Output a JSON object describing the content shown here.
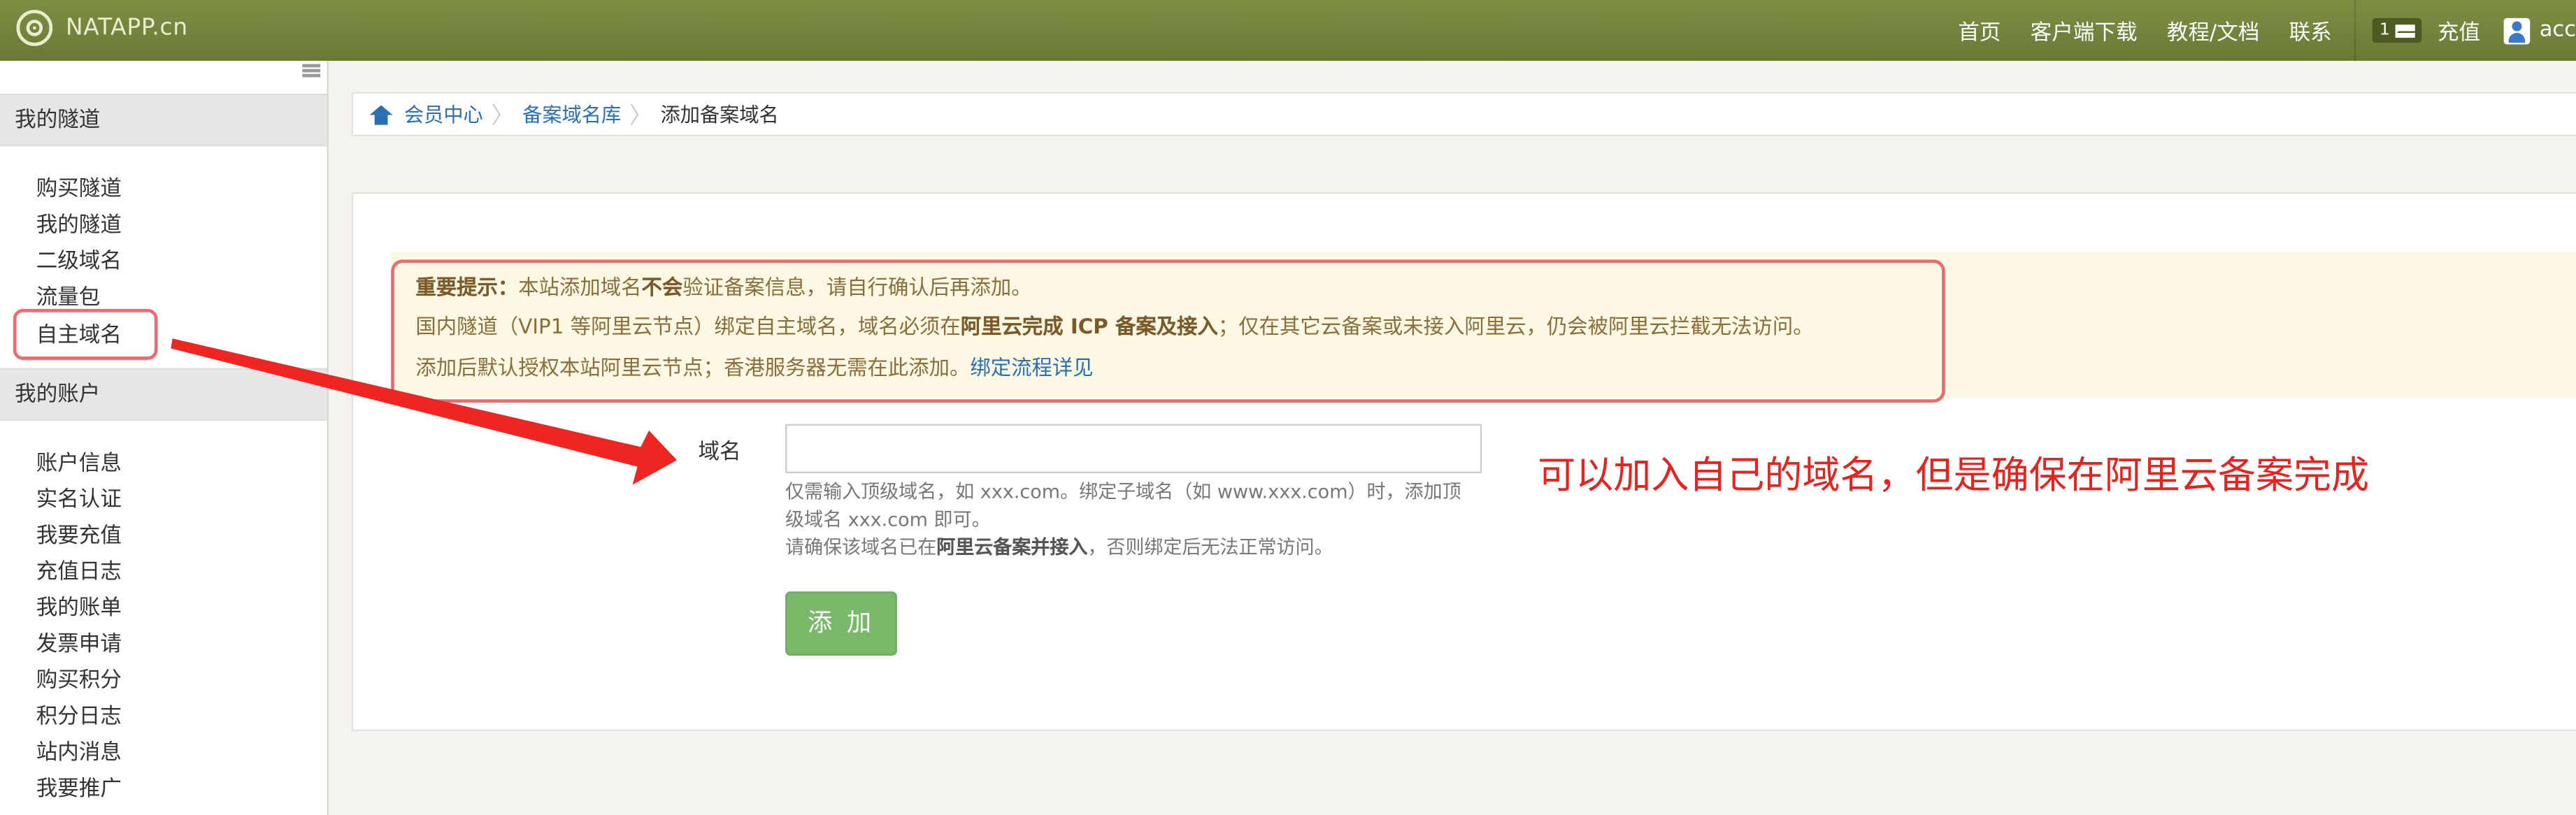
{
  "header": {
    "brand": "NATAPP.cn",
    "nav": [
      "首页",
      "客户端下载",
      "教程/文档",
      "联系"
    ],
    "message_count": "1",
    "recharge": "充值",
    "user": "acc"
  },
  "sidebar": {
    "section_tunnels": "我的隧道",
    "tunnel_items": [
      "购买隧道",
      "我的隧道",
      "二级域名",
      "流量包",
      "自主域名"
    ],
    "section_account": "我的账户",
    "account_items": [
      "账户信息",
      "实名认证",
      "我要充值",
      "充值日志",
      "我的账单",
      "发票申请",
      "购买积分",
      "积分日志",
      "站内消息",
      "我要推广"
    ]
  },
  "breadcrumb": {
    "home": "会员中心",
    "parent": "备案域名库",
    "current": "添加备案域名"
  },
  "alert": {
    "line1_label": "重要提示：",
    "line1_a": "本站添加域名",
    "line1_bold": "不会",
    "line1_b": "验证备案信息，请自行确认后再添加。",
    "line2_a": "国内隧道（VIP1 等阿里云节点）绑定自主域名，域名必须在",
    "line2_bold": "阿里云完成 ICP 备案及接入",
    "line2_b": "；仅在其它云备案或未接入阿里云，仍会被阿里云拦截无法访问。",
    "line3_a": "添加后默认授权本站阿里云节点；香港服务器无需在此添加。",
    "line3_link": "绑定流程详见"
  },
  "form": {
    "label": "域名",
    "value": "",
    "help1": "仅需输入顶级域名，如 xxx.com。绑定子域名（如 www.xxx.com）时，添加顶",
    "help2": "级域名 xxx.com 即可。",
    "help3_a": "请确保该域名已在",
    "help3_bold": "阿里云备案并接入",
    "help3_b": "，否则绑定后无法正常访问。",
    "submit": "添 加"
  },
  "annotation": {
    "text": "可以加入自己的域名，但是确保在阿里云备案完成",
    "color": "#e8231f"
  },
  "colors": {
    "topbar": "#748540",
    "link": "#2a6fb4",
    "button": "#78b96a",
    "highlight": "#ee6a6f"
  }
}
